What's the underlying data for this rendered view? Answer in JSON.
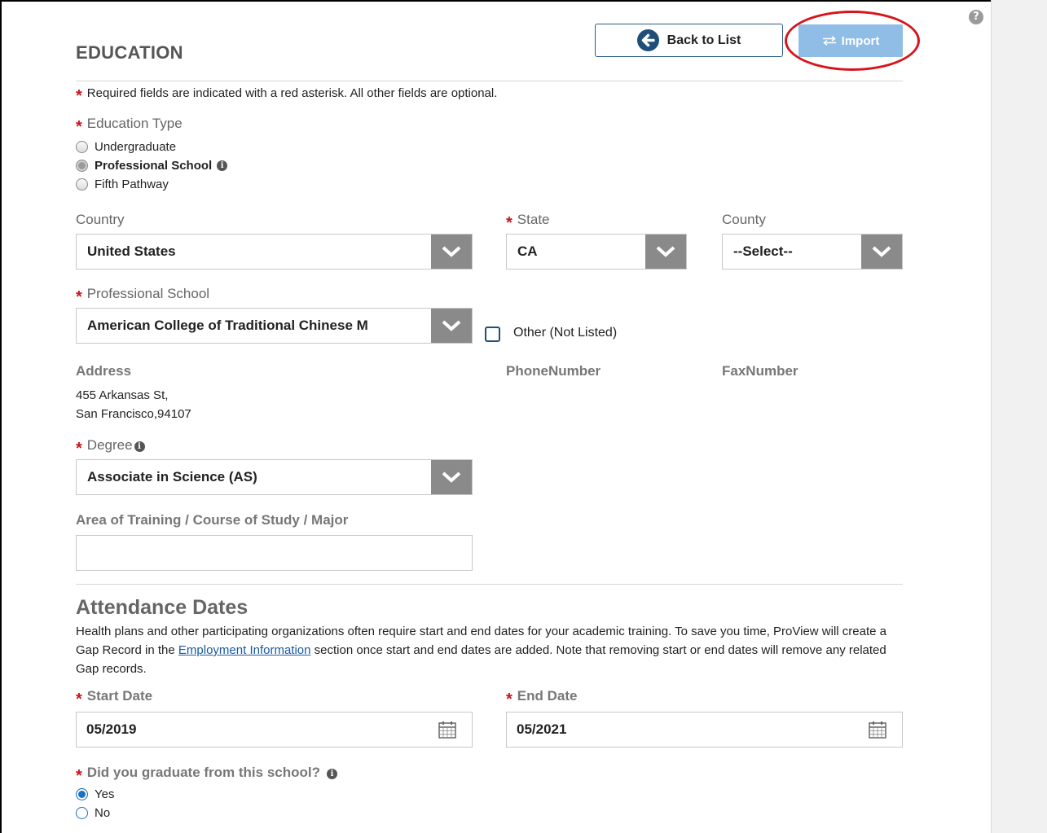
{
  "page": {
    "section_title": "EDUCATION",
    "required_note": "Required fields are indicated with a red asterisk. All other fields are optional."
  },
  "toolbar": {
    "back_label": "Back to List",
    "import_label": "Import"
  },
  "education_type": {
    "label": "Education Type",
    "options": [
      "Undergraduate",
      "Professional School",
      "Fifth Pathway"
    ],
    "selected": "Professional School"
  },
  "location": {
    "country_label": "Country",
    "country_value": "United States",
    "state_label": "State",
    "state_value": "CA",
    "county_label": "County",
    "county_value": "--Select--"
  },
  "school": {
    "label": "Professional School",
    "value": "American College of Traditional Chinese M",
    "other_label": "Other (Not Listed)"
  },
  "contact": {
    "address_label": "Address",
    "address_line1": "455 Arkansas St,",
    "address_line2": "San Francisco,94107",
    "phone_label": "PhoneNumber",
    "fax_label": "FaxNumber"
  },
  "degree": {
    "label": "Degree",
    "value": "Associate in Science (AS)"
  },
  "major": {
    "label": "Area of Training / Course of Study / Major",
    "value": ""
  },
  "attendance": {
    "heading": "Attendance Dates",
    "para_part1": "Health plans and other participating organizations often require start and end dates for your academic training. To save you time, ProView will create a Gap Record in the ",
    "link_text": "Employment Information",
    "para_part2": " section once start and end dates are added. Note that removing start or end dates will remove any related Gap records.",
    "start_label": "Start Date",
    "start_value": "05/2019",
    "end_label": "End Date",
    "end_value": "05/2021"
  },
  "graduated": {
    "label": "Did you graduate from this school?",
    "options": [
      "Yes",
      "No"
    ],
    "selected": "Yes"
  },
  "colors": {
    "required": "#c9141b",
    "primary": "#1f4e79",
    "import_button": "#8fbde6",
    "highlight": "#d8141b"
  }
}
